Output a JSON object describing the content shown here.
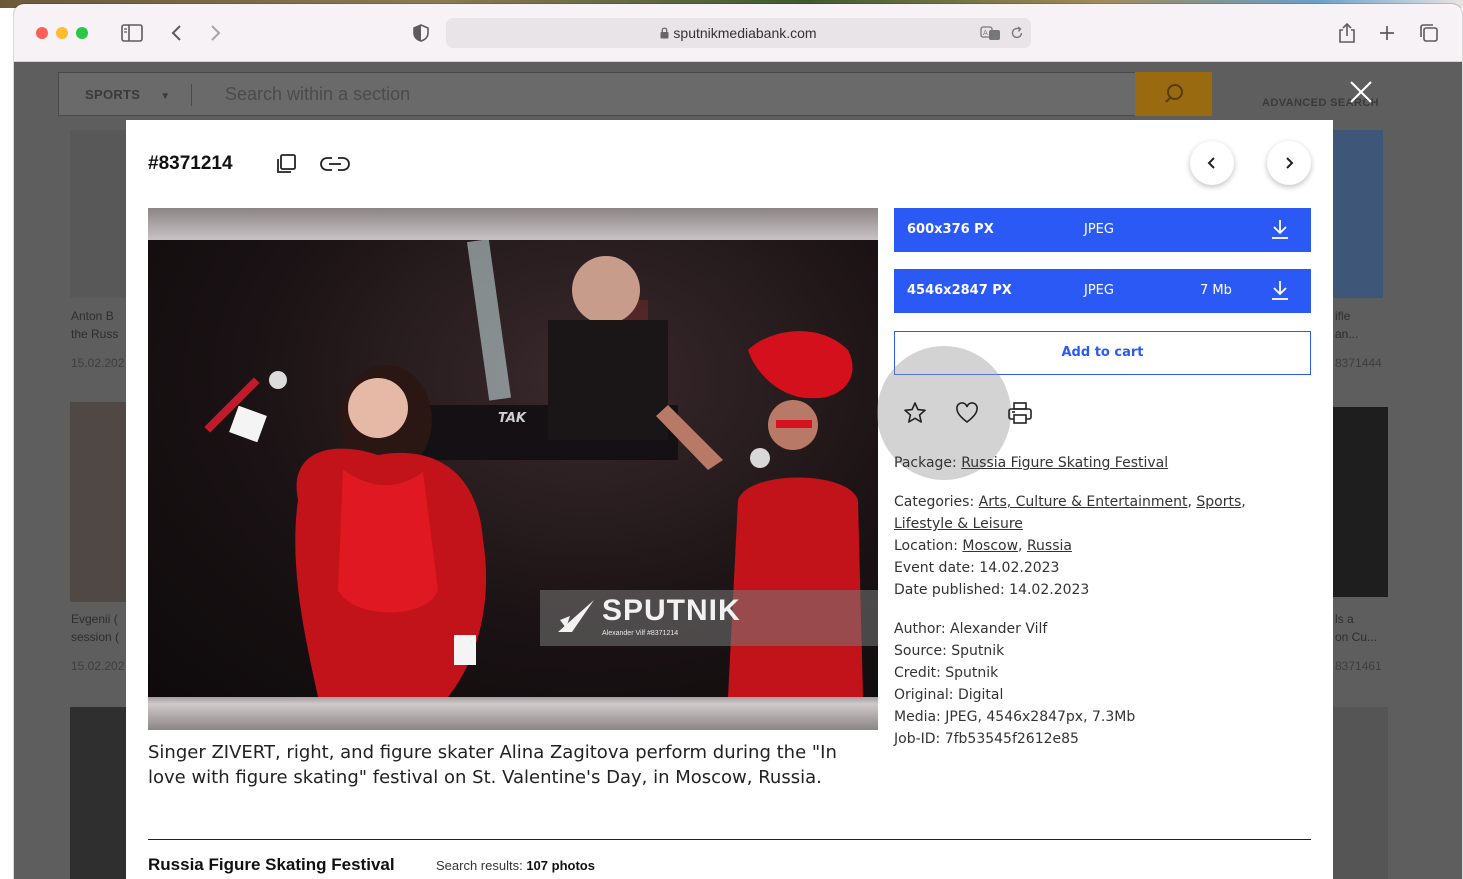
{
  "browser": {
    "url": "sputnikmediabank.com"
  },
  "background_page": {
    "section_label": "SPORTS",
    "search_placeholder": "Search within a section",
    "advanced_search": "ADVANCED SEARCH",
    "cards": [
      {
        "line1": "Anton B",
        "line2": "the Russ",
        "date": "15.02.202"
      },
      {
        "line1": "Evgenii (",
        "line2": "session (",
        "date": "15.02.202"
      },
      {
        "line1": "ifle",
        "line2": "an...",
        "date": "8371444"
      },
      {
        "line1": "ls a",
        "line2": "on Cu...",
        "date": "8371461"
      }
    ]
  },
  "modal": {
    "photo_id": "#8371214",
    "watermark": {
      "brand": "SPUTNIK",
      "credit_line": "Alexander Vilf #8371214"
    },
    "caption": "Singer ZIVERT, right, and figure skater Alina Zagitova perform during the \"In love with figure skating\" festival on St. Valentine's Day, in Moscow, Russia.",
    "downloads": [
      {
        "size": "600x376 PX",
        "format": "JPEG",
        "weight": ""
      },
      {
        "size": "4546x2847 PX",
        "format": "JPEG",
        "weight": "7 Mb"
      }
    ],
    "add_to_cart": "Add to cart",
    "package": {
      "label": "Package:",
      "value": "Russia Figure Skating Festival"
    },
    "categories": {
      "label": "Categories:",
      "items": [
        "Arts, Culture & Entertainment",
        "Sports",
        "Lifestyle & Leisure"
      ]
    },
    "location": {
      "label": "Location:",
      "items": [
        "Moscow",
        "Russia"
      ]
    },
    "event_date": "Event date: 14.02.2023",
    "date_published": "Date published: 14.02.2023",
    "author": "Author: Alexander Vilf",
    "source": "Source: Sputnik",
    "credit": "Credit: Sputnik",
    "original": "Original: Digital",
    "media": "Media: JPEG, 4546x2847px, 7.3Mb",
    "job_id": "Job-ID: 7fb53545f2612e85",
    "footer": {
      "package_title": "Russia Figure Skating Festival",
      "results_label": "Search results:",
      "results_count": "107 photos"
    }
  }
}
